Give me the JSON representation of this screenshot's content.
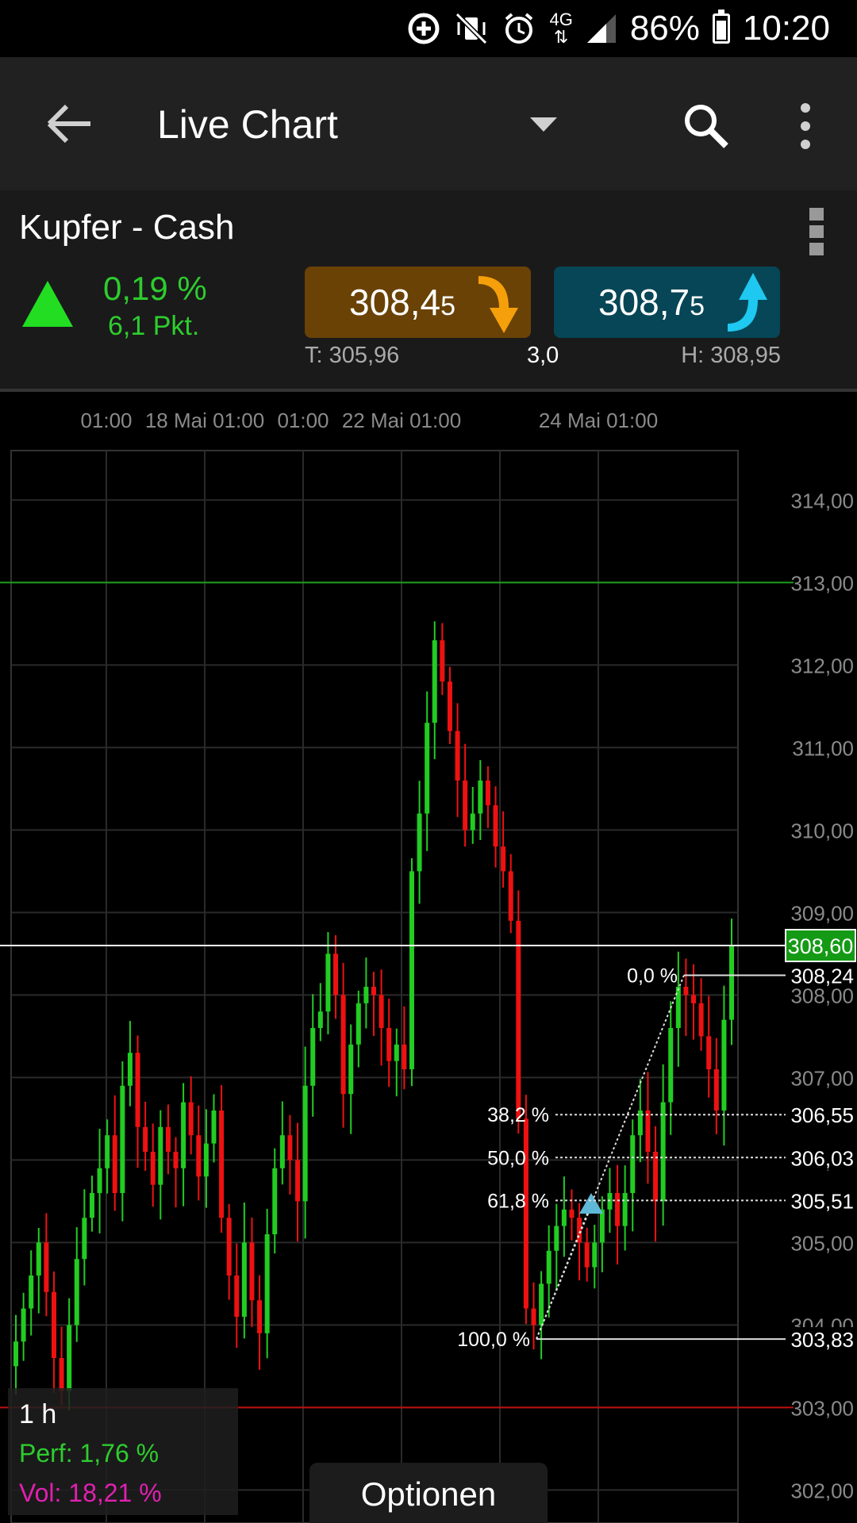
{
  "status_bar": {
    "battery": "86%",
    "time": "10:20",
    "network": "4G",
    "icons": [
      "data-saver-icon",
      "mute-vibrate-icon",
      "alarm-icon",
      "network-4g-icon",
      "signal-icon",
      "battery-icon"
    ]
  },
  "app_bar": {
    "title": "Live Chart",
    "icons": [
      "back-arrow-icon",
      "dropdown-caret-icon",
      "search-icon",
      "more-vert-icon"
    ]
  },
  "instrument": {
    "name": "Kupfer - Cash",
    "change_pct": "0,19 %",
    "change_pts": "6,1 Pkt.",
    "trend": "up",
    "bid_main": "308,4",
    "bid_small": "5",
    "ask_main": "308,7",
    "ask_small": "5",
    "low": "T: 305,96",
    "spread": "3,0",
    "high": "H: 308,95",
    "colors": {
      "up": "#22dd22",
      "bid_bg": "#6a4206",
      "ask_bg": "#064656",
      "bid_arrow": "#f5a00a",
      "ask_arrow": "#1ec8f0"
    }
  },
  "chart_data": {
    "type": "candlestick",
    "interval": "1 h",
    "x_tick_labels": [
      "01:00",
      "18 Mai 01:00",
      "01:00",
      "22 Mai 01:00",
      "24 Mai 01:00"
    ],
    "y_ticks": [
      314,
      313,
      312,
      311,
      310,
      309,
      308,
      307,
      306,
      305,
      304,
      303,
      302
    ],
    "y_tick_labels": [
      "314,00",
      "313,00",
      "312,00",
      "311,00",
      "310,00",
      "309,00",
      "308,00",
      "307,00",
      "306,00",
      "305,00",
      "304,00",
      "303,00",
      "302,00"
    ],
    "ylim": [
      301.6,
      314.6
    ],
    "current_price": 308.6,
    "current_price_label": "308,60",
    "high_line": 313.0,
    "low_line": 303.0,
    "series_close": [
      303.8,
      304.2,
      304.6,
      305.0,
      304.4,
      303.6,
      303.2,
      304.0,
      304.8,
      305.3,
      305.6,
      305.9,
      306.3,
      305.6,
      306.9,
      307.3,
      306.4,
      306.1,
      305.7,
      306.4,
      306.1,
      305.9,
      306.7,
      306.3,
      305.8,
      306.2,
      306.6,
      305.3,
      304.6,
      304.1,
      305.0,
      304.3,
      303.9,
      305.1,
      305.9,
      306.3,
      306.0,
      305.5,
      306.9,
      307.6,
      307.8,
      308.5,
      308.0,
      306.8,
      307.4,
      307.9,
      308.1,
      308.0,
      307.6,
      307.2,
      307.4,
      307.1,
      309.5,
      310.2,
      311.3,
      312.3,
      311.8,
      311.2,
      310.6,
      310.0,
      310.2,
      310.6,
      310.3,
      309.8,
      309.5,
      308.9,
      306.5,
      304.2,
      304.0,
      304.5,
      304.9,
      305.2,
      305.4,
      305.3,
      305.0,
      304.7,
      305.0,
      305.4,
      305.6,
      305.2,
      305.6,
      306.3,
      306.6,
      306.1,
      305.5,
      306.7,
      307.6,
      308.1,
      308.0,
      307.9,
      307.5,
      307.1,
      306.6,
      307.7,
      308.6
    ],
    "fibonacci": {
      "levels": [
        {
          "pct": "0,0 %",
          "value": "308,24",
          "price": 308.24
        },
        {
          "pct": "38,2 %",
          "value": "306,55",
          "price": 306.55
        },
        {
          "pct": "50,0 %",
          "value": "306,03",
          "price": 306.03
        },
        {
          "pct": "61,8 %",
          "value": "305,51",
          "price": 305.51
        },
        {
          "pct": "100,0 %",
          "value": "303,83",
          "price": 303.83
        }
      ]
    },
    "colors": {
      "up": "#22cc22",
      "down": "#ee1111",
      "grid": "#2a2a2a",
      "high_line": "#1e9e1e",
      "low_line": "#c01010",
      "price_box": "#159a15"
    }
  },
  "info": {
    "interval": "1 h",
    "perf": "Perf: 1,76 %",
    "vol": "Vol: 18,21 %"
  },
  "options_label": "Optionen"
}
